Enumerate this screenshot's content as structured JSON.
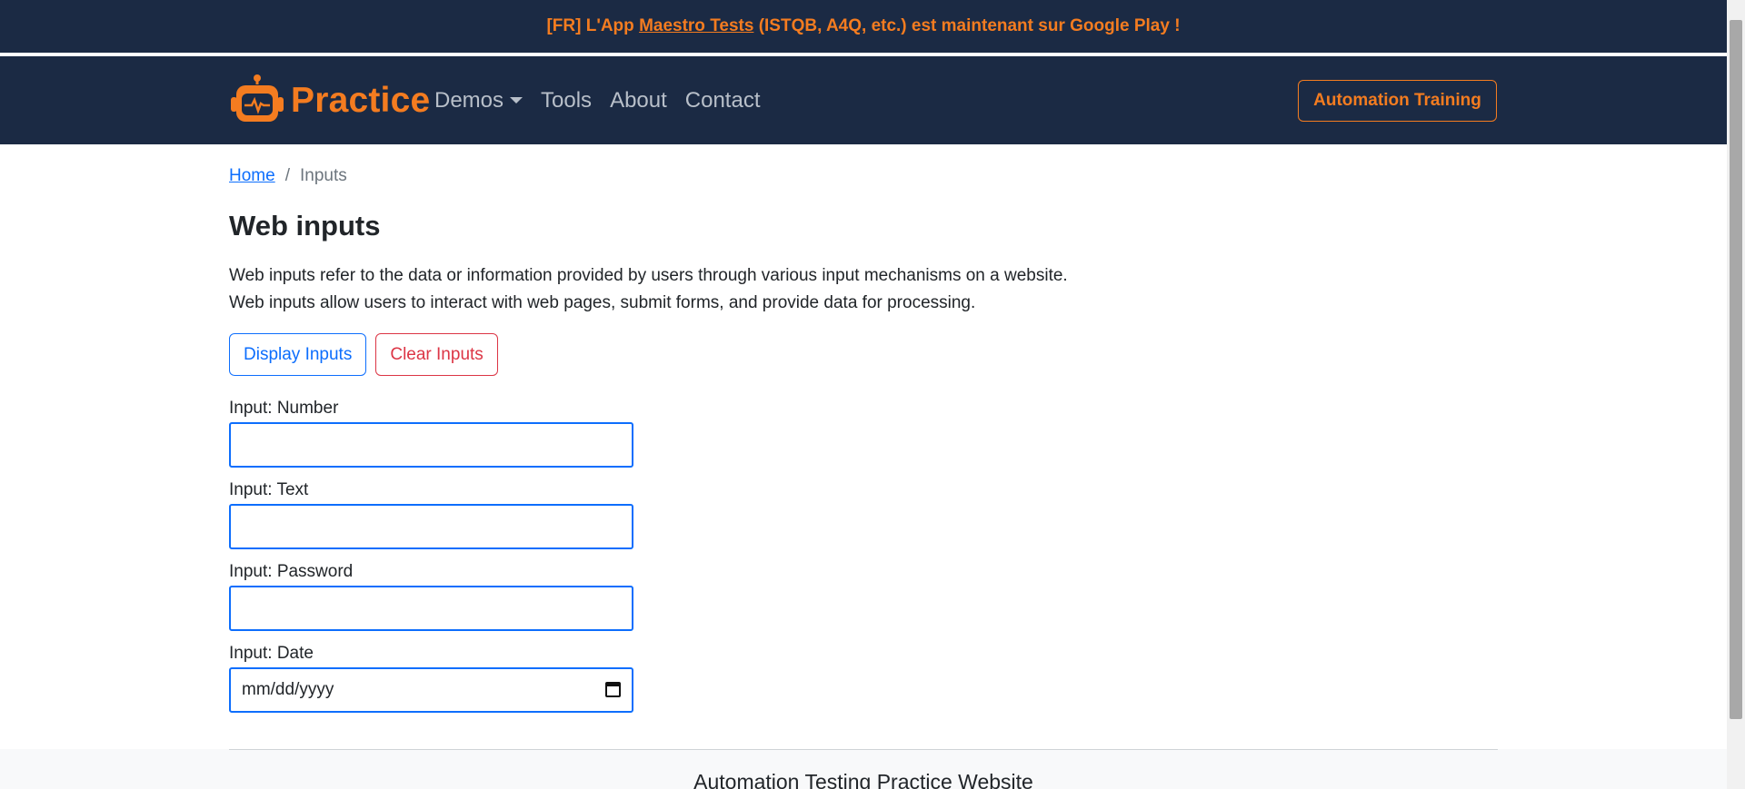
{
  "announcement": {
    "prefix": "[FR] L'App ",
    "link": "Maestro Tests",
    "suffix": " (ISTQB, A4Q, etc.) est maintenant sur Google Play !"
  },
  "navbar": {
    "brand": "Practice",
    "links": [
      "Demos",
      "Tools",
      "About",
      "Contact"
    ],
    "training_button": "Automation Training"
  },
  "breadcrumb": {
    "home": "Home",
    "separator": "/",
    "current": "Inputs"
  },
  "page": {
    "title": "Web inputs",
    "description_line1": "Web inputs refer to the data or information provided by users through various input mechanisms on a website.",
    "description_line2": "Web inputs allow users to interact with web pages, submit forms, and provide data for processing."
  },
  "buttons": {
    "display": "Display Inputs",
    "clear": "Clear Inputs"
  },
  "fields": {
    "number_label": "Input: Number",
    "number_value": "",
    "text_label": "Input: Text",
    "text_value": "",
    "password_label": "Input: Password",
    "password_value": "",
    "date_label": "Input: Date",
    "date_placeholder": "mm/dd/yyyy"
  },
  "footer": {
    "title": "Automation Testing Practice Website"
  },
  "colors": {
    "navy": "#1b2a44",
    "accent_orange": "#f47c20",
    "primary_blue": "#0d6efd",
    "danger_red": "#dc3545"
  },
  "icons": [
    "robot-logo-icon",
    "caret-down-icon",
    "calendar-icon"
  ]
}
